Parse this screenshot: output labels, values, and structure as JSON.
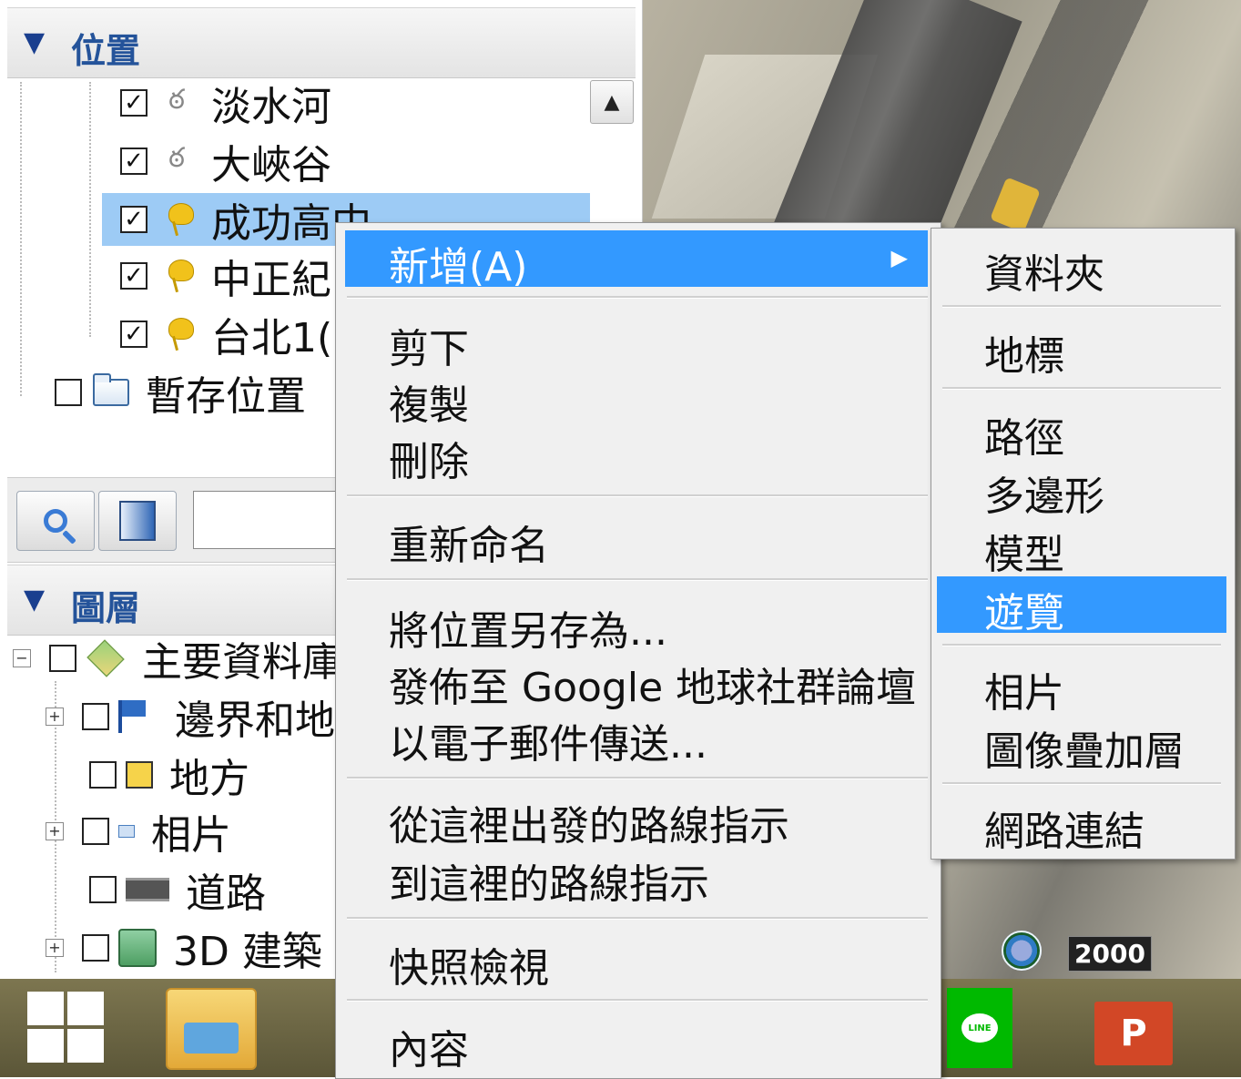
{
  "places": {
    "header": "位置",
    "items": [
      {
        "label": "淡水河",
        "checked": true,
        "icon": "path-icon"
      },
      {
        "label": "大峽谷",
        "checked": true,
        "icon": "path-icon"
      },
      {
        "label": "成功高中",
        "checked": true,
        "icon": "placemark-icon",
        "selected": true
      },
      {
        "label": "中正紀",
        "checked": true,
        "icon": "placemark-icon"
      },
      {
        "label": "台北1(",
        "checked": true,
        "icon": "placemark-icon"
      }
    ],
    "temp": {
      "label": "暫存位置",
      "checked": false,
      "icon": "folder-icon"
    }
  },
  "layers": {
    "header": "圖層",
    "items": [
      {
        "label": "主要資料庫",
        "expand": "−",
        "icon": "layers-icon"
      },
      {
        "label": "邊界和地",
        "expand": "+",
        "icon": "flag-icon"
      },
      {
        "label": "地方",
        "expand": "",
        "icon": "square-icon"
      },
      {
        "label": "相片",
        "expand": "+",
        "icon": "photo-icon"
      },
      {
        "label": "道路",
        "expand": "",
        "icon": "road-icon"
      },
      {
        "label": "3D 建築",
        "expand": "+",
        "icon": "building-icon"
      }
    ]
  },
  "context_menu": {
    "add": "新增(A)",
    "cut": "剪下",
    "copy": "複製",
    "delete": "刪除",
    "rename": "重新命名",
    "save_as": "將位置另存為...",
    "publish": "發佈至 Google 地球社群論壇",
    "email": "以電子郵件傳送...",
    "directions_from": "從這裡出發的路線指示",
    "directions_to": "到這裡的路線指示",
    "snapshot": "快照檢視",
    "properties": "內容"
  },
  "submenu": {
    "folder": "資料夾",
    "placemark": "地標",
    "path": "路徑",
    "polygon": "多邊形",
    "model": "模型",
    "tour": "遊覽",
    "photo": "相片",
    "image_overlay": "圖像疊加層",
    "network_link": "網路連結"
  },
  "map": {
    "year": "2000"
  },
  "taskbar": {
    "line_label": "LINE",
    "ppt_label": "P"
  },
  "colors": {
    "selection": "#3399ff",
    "tree_selection": "#9dcbf5",
    "header_text": "#24539a"
  }
}
